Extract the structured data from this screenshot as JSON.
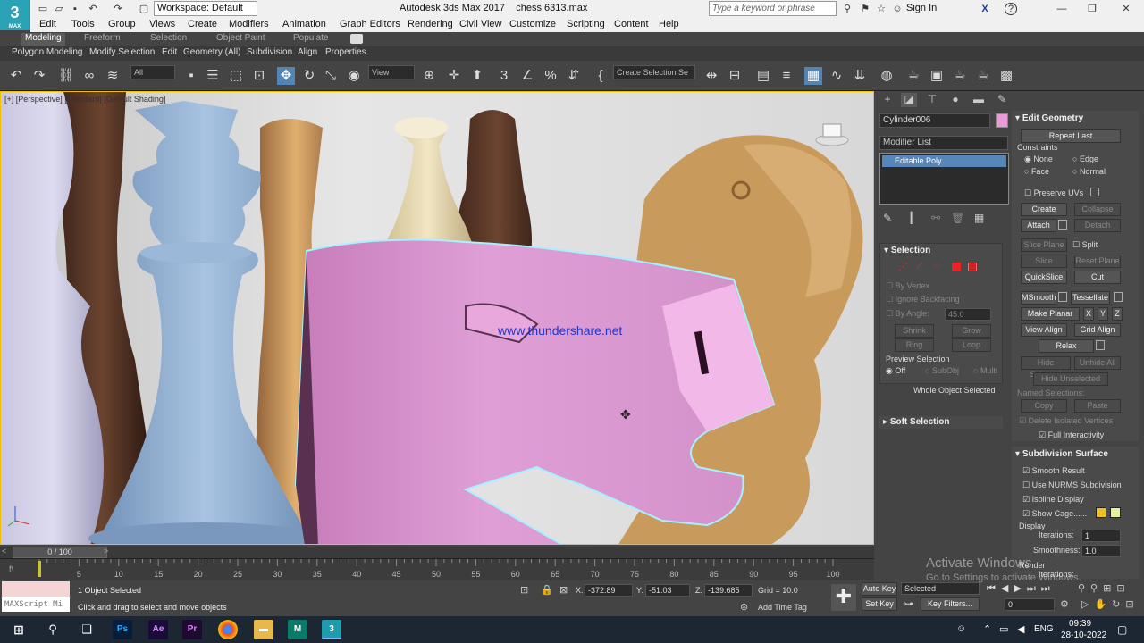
{
  "titlebar": {
    "logo_text": "3",
    "logo_sub": "MAX",
    "workspace": "Workspace: Default",
    "app_name": "Autodesk 3ds Max 2017",
    "file_name": "chess 6313.max",
    "search_placeholder": "Type a keyword or phrase",
    "sign_in": "Sign In",
    "help_icon": "?"
  },
  "menu": [
    "Edit",
    "Tools",
    "Group",
    "Views",
    "Create",
    "Modifiers",
    "Animation",
    "Graph Editors",
    "Rendering",
    "Civil View",
    "Customize",
    "Scripting",
    "Content",
    "Help"
  ],
  "ribbon_tabs": [
    "Modeling",
    "Freeform",
    "Selection",
    "Object Paint",
    "Populate"
  ],
  "ribbon_sub": [
    "Polygon Modeling",
    "Modify Selection",
    "Edit",
    "Geometry (All)",
    "Subdivision",
    "Align",
    "Properties"
  ],
  "toolbar": {
    "filter": "All",
    "ref_coord": "View",
    "selection_set": "Create Selection Se"
  },
  "viewport": {
    "label": "[+] [Perspective] [Standard] [Default Shading]",
    "watermark": "www.thundershare.net"
  },
  "command_panel": {
    "object_name": "Cylinder006",
    "object_color": "#e99bd8",
    "modifier_list": "Modifier List",
    "stack_item": "Editable Poly",
    "selection": {
      "header": "Selection",
      "by_vertex": "By Vertex",
      "ignore_backfacing": "Ignore Backfacing",
      "by_angle": "By Angle:",
      "angle_value": "45.0",
      "shrink": "Shrink",
      "grow": "Grow",
      "ring": "Ring",
      "loop": "Loop",
      "preview_selection": "Preview Selection",
      "off": "Off",
      "subobj": "SubObj",
      "multi": "Multi",
      "status": "Whole Object Selected"
    },
    "soft_selection": "Soft Selection",
    "edit_geometry": {
      "header": "Edit Geometry",
      "repeat_last": "Repeat Last",
      "constraints": "Constraints",
      "none": "None",
      "edge": "Edge",
      "face": "Face",
      "normal": "Normal",
      "preserve_uvs": "Preserve UVs",
      "create": "Create",
      "collapse": "Collapse",
      "attach": "Attach",
      "detach": "Detach",
      "slice_plane": "Slice Plane",
      "split": "Split",
      "slice": "Slice",
      "reset_plane": "Reset Plane",
      "quickslice": "QuickSlice",
      "cut": "Cut",
      "msmooth": "MSmooth",
      "tessellate": "Tessellate",
      "make_planar": "Make Planar",
      "x": "X",
      "y": "Y",
      "z": "Z",
      "view_align": "View Align",
      "grid_align": "Grid Align",
      "relax": "Relax",
      "hide_selected": "Hide Selected",
      "unhide_all": "Unhide All",
      "hide_unselected": "Hide Unselected",
      "named_selections": "Named Selections:",
      "copy": "Copy",
      "paste": "Paste",
      "delete_isolated": "Delete Isolated Vertices",
      "full_interactivity": "Full Interactivity"
    },
    "subdivision_surface": {
      "header": "Subdivision Surface",
      "smooth_result": "Smooth Result",
      "use_nurms": "Use NURMS Subdivision",
      "isoline_display": "Isoline Display",
      "show_cage": "Show Cage......",
      "display": "Display",
      "iterations": "Iterations:",
      "iterations_value": "1",
      "smoothness": "Smoothness:",
      "smoothness_value": "1.0",
      "render": "Render",
      "render_iterations": "Iterations:",
      "cage_color_1": "#f0c020",
      "cage_color_2": "#e8f0a0"
    }
  },
  "timeline": {
    "frame": "0 / 100",
    "ticks": [
      "0",
      "5",
      "10",
      "15",
      "20",
      "25",
      "30",
      "35",
      "40",
      "45",
      "50",
      "55",
      "60",
      "65",
      "70",
      "75",
      "80",
      "85",
      "90",
      "95",
      "100"
    ]
  },
  "status": {
    "maxscript": "MAXScript Mi",
    "objects_selected": "1 Object Selected",
    "prompt": "Click and drag to select and move objects",
    "x_label": "X:",
    "x": "-372.89",
    "y_label": "Y:",
    "y": "-51.03",
    "z_label": "Z:",
    "z": "-139.685",
    "grid": "Grid = 10.0",
    "add_time_tag": "Add Time Tag",
    "auto_key": "Auto Key",
    "selected": "Selected",
    "set_key": "Set Key",
    "key_filters": "Key Filters...",
    "frame_value": "0"
  },
  "activate": {
    "title": "Activate Windows",
    "subtitle": "Go to Settings to activate Windows."
  },
  "taskbar": {
    "lang": "ENG",
    "time": "09:39",
    "date": "28-10-2022",
    "apps": [
      "Ps",
      "Ae",
      "Pr",
      "M",
      "3"
    ]
  }
}
